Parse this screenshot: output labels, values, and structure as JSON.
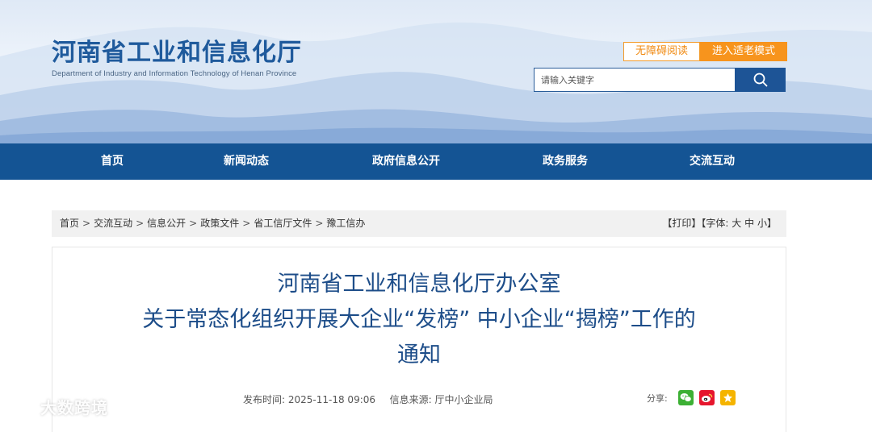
{
  "header": {
    "site_title": "河南省工业和信息化厅",
    "site_subtitle": "Department of Industry and Information Technology of Henan Province",
    "accessibility_label": "无障碍阅读",
    "elder_mode_label": "进入适老模式",
    "search": {
      "placeholder": "请输入关键字",
      "value": "",
      "icon": "search-icon"
    }
  },
  "nav": {
    "items": [
      {
        "label": "首页"
      },
      {
        "label": "新闻动态"
      },
      {
        "label": "政府信息公开"
      },
      {
        "label": "政务服务"
      },
      {
        "label": "交流互动"
      }
    ]
  },
  "breadcrumb": {
    "items": [
      "首页",
      "交流互动",
      "信息公开",
      "政策文件",
      "省工信厅文件",
      "豫工信办"
    ],
    "separator": ">"
  },
  "tools": {
    "print_label": "【打印】",
    "font_label": "【字体:",
    "size_large": "大",
    "size_medium": "中",
    "size_small": "小",
    "close_bracket": "】"
  },
  "article": {
    "title_lines": [
      "河南省工业和信息化厅办公室",
      "关于常态化组织开展大企业“发榜” 中小企业“揭榜”工作的",
      "通知"
    ],
    "publish_label": "发布时间:",
    "publish_time": "2025-11-18 09:06",
    "source_label": "信息来源:",
    "source": "厅中小企业局",
    "share_label": "分享:",
    "share_icons": [
      "wechat-icon",
      "weibo-icon",
      "qzone-icon"
    ]
  },
  "watermark": {
    "text": "大数跨境"
  },
  "colors": {
    "brand_blue": "#145494",
    "title_blue": "#1d4d89",
    "orange": "#f7941d",
    "wechat": "#3cb034",
    "weibo": "#e6162d",
    "qzone": "#f5b400"
  }
}
